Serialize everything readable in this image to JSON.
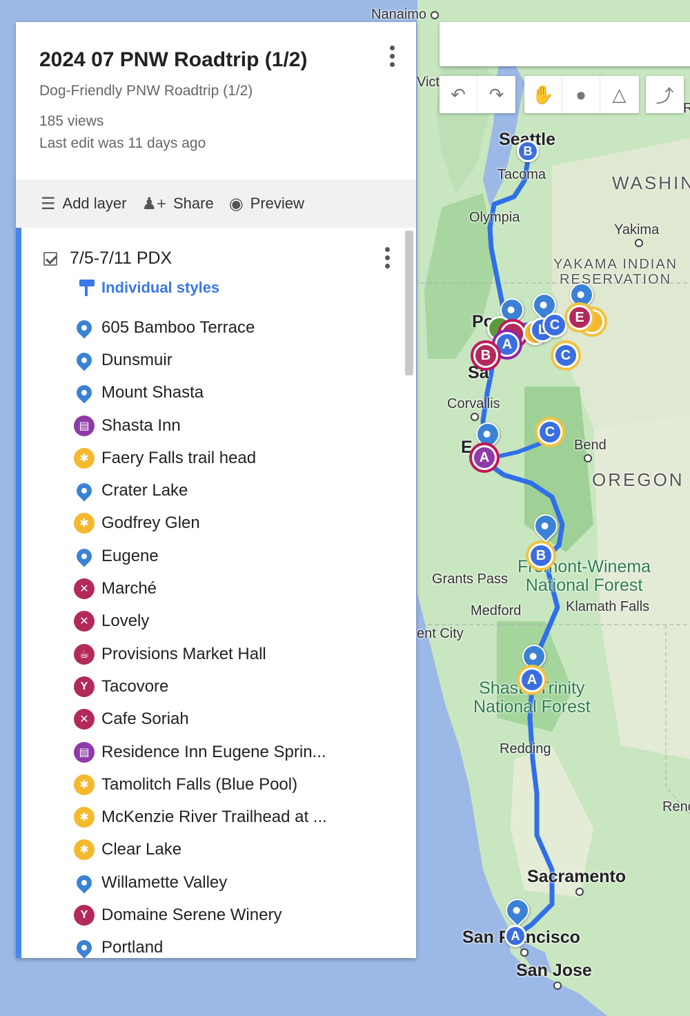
{
  "map": {
    "labels": {
      "nanaimo": "Nanaimo",
      "victoria": "Vict",
      "seattle": "Seattle",
      "tacoma": "Tacoma",
      "olympia": "Olympia",
      "washington": "WASHIN",
      "yakima": "Yakima",
      "yakama_line1": "YAKAMA INDIAN",
      "yakama_line2": "RESERVATION",
      "portland": "Po",
      "salem": "Sa",
      "corvallis": "Corvallis",
      "eugene": "E",
      "bend": "Bend",
      "oregon": "OREGON",
      "fremont_line1": "Fremont-Winema",
      "fremont_line2": "National Forest",
      "grants_pass": "Grants Pass",
      "medford": "Medford",
      "klamath": "Klamath Falls",
      "crescent": "ent City",
      "shasta_line1": "Shasta-Trinity",
      "shasta_line2": "National Forest",
      "redding": "Redding",
      "reno": "Reno",
      "sacramento": "Sacramento",
      "san_francisco": "San Francisco",
      "san_jose": "San Jose",
      "r_edge": "R"
    },
    "pin_letters": [
      "A",
      "B",
      "C",
      "E",
      "L"
    ],
    "colors": {
      "route": "#2f6fe8",
      "water": "#9bb8e6",
      "land": "#c9e6c4"
    }
  },
  "toolbar": {
    "undo_icon": "undo-icon",
    "redo_icon": "redo-icon",
    "hand_icon": "hand-icon",
    "marker_icon": "marker-icon",
    "line_icon": "draw-line-icon",
    "directions_icon": "directions-icon"
  },
  "panel": {
    "title": "2024 07 PNW Roadtrip (1/2)",
    "description": "Dog-Friendly PNW Roadtrip (1/2)",
    "views": "185 views",
    "last_edit": "Last edit was 11 days ago",
    "actions": {
      "add_layer": "Add layer",
      "share": "Share",
      "preview": "Preview"
    },
    "layer": {
      "name": "7/5-7/11 PDX",
      "styles": "Individual styles",
      "items": [
        {
          "label": "605 Bamboo Terrace",
          "icon": "pin"
        },
        {
          "label": "Dunsmuir",
          "icon": "pin"
        },
        {
          "label": "Mount Shasta",
          "icon": "pin"
        },
        {
          "label": "Shasta Inn",
          "icon": "hotel"
        },
        {
          "label": "Faery Falls trail head",
          "icon": "hiking"
        },
        {
          "label": "Crater Lake",
          "icon": "pin"
        },
        {
          "label": "Godfrey Glen",
          "icon": "hiking"
        },
        {
          "label": "Eugene",
          "icon": "pin"
        },
        {
          "label": "Marché",
          "icon": "restaurant"
        },
        {
          "label": "Lovely",
          "icon": "restaurant"
        },
        {
          "label": "Provisions Market Hall",
          "icon": "cafe"
        },
        {
          "label": "Tacovore",
          "icon": "bar"
        },
        {
          "label": "Cafe Soriah",
          "icon": "restaurant"
        },
        {
          "label": "Residence Inn Eugene Sprin...",
          "icon": "hotel"
        },
        {
          "label": "Tamolitch Falls (Blue Pool)",
          "icon": "hiking"
        },
        {
          "label": "McKenzie River Trailhead at ...",
          "icon": "hiking"
        },
        {
          "label": "Clear Lake",
          "icon": "hiking"
        },
        {
          "label": "Willamette Valley",
          "icon": "pin"
        },
        {
          "label": "Domaine Serene Winery",
          "icon": "bar"
        },
        {
          "label": "Portland",
          "icon": "pin"
        }
      ]
    }
  }
}
